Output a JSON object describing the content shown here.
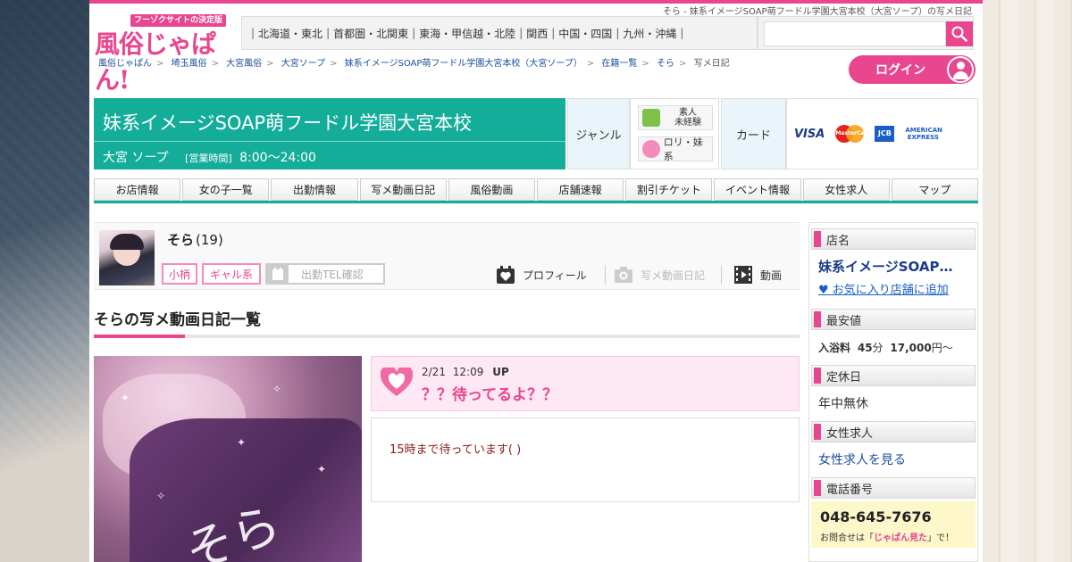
{
  "header": {
    "page_subtitle": "そら - 妹系イメージSOAP萌フードル学園大宮本校（大宮ソープ）の写メ日記",
    "logo_tagline": "フーゾクサイトの決定版",
    "logo_text": "風俗じゃぱん!",
    "regions": [
      "北海道・東北",
      "首都圏・北関東",
      "東海・甲信越・北陸",
      "関西",
      "中国・四国",
      "九州・沖縄"
    ],
    "search_placeholder": "",
    "login_label": "ログイン"
  },
  "breadcrumb": {
    "items": [
      "風俗じゃぱん",
      "埼玉風俗",
      "大宮風俗",
      "大宮ソープ",
      "妹系イメージSOAP萌フードル学園大宮本校（大宮ソープ）",
      "在籍一覧",
      "そら"
    ],
    "current": "写メ日記"
  },
  "shop": {
    "name": "妹系イメージSOAP萌フードル学園大宮本校",
    "area": "大宮 ソープ",
    "hours_label": "[営業時間]",
    "hours": "8:00～24:00",
    "genre_label": "ジャンル",
    "genre_tags": [
      "素人\n未経験",
      "ロリ・妹系"
    ],
    "card_label": "カード",
    "cards": [
      "VISA",
      "MasterCard",
      "JCB",
      "AMERICAN EXPRESS"
    ]
  },
  "nav": [
    "お店情報",
    "女の子一覧",
    "出勤情報",
    "写メ動画日記",
    "風俗動画",
    "店舗速報",
    "割引チケット",
    "イベント情報",
    "女性求人",
    "マップ"
  ],
  "profile": {
    "name": "そら",
    "age": "(19)",
    "tags": [
      "小柄",
      "ギャル系"
    ],
    "tel_label": "出勤TEL確認",
    "links": {
      "profile": "プロフィール",
      "diary": "写メ動画日記",
      "video": "動画"
    }
  },
  "diary": {
    "section_title": "そらの写メ動画日記一覧",
    "photo_sign": "そら",
    "post_date": "2/21",
    "post_time": "12:09",
    "post_up": "UP",
    "post_title": "？？待ってるよ？？",
    "post_text": "15時まで待っています( )"
  },
  "sidebar": {
    "shop_heading": "店名",
    "shop_name": "妹系イメージSOAP…",
    "favorite_link": "♥ お気に入り店舗に追加",
    "price_heading": "最安値",
    "price_label": "入浴料",
    "price_minutes": "45",
    "price_minutes_unit": "分",
    "price_amount": "17,000",
    "price_unit": "円～",
    "holiday_heading": "定休日",
    "holiday": "年中無休",
    "recruit_heading": "女性求人",
    "recruit_link": "女性求人を見る",
    "phone_heading": "電話番号",
    "phone": "048-645-7676",
    "phone_note_pre": "お問合せは「",
    "phone_note_em": "じゃぱん見た",
    "phone_note_post": "」で！"
  },
  "colors": {
    "accent": "#e8468f",
    "shop_header": "#14ad99",
    "link": "#1a4e9e"
  }
}
